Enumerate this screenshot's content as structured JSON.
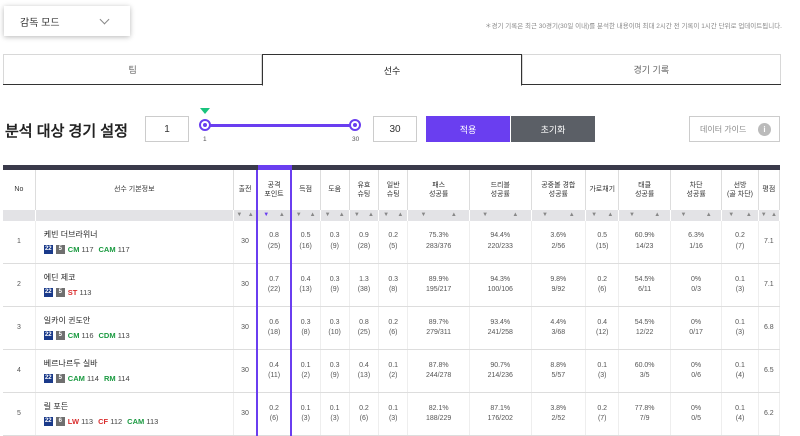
{
  "mode": {
    "label": "감독 모드"
  },
  "notice": "＊경기 기록은 최근 30경기(30일 이내)를 분석한 내용이며 최대 2시간 전 기록이 1시간 단위로 업데이트됩니다.",
  "tabs": [
    "팀",
    "선수",
    "경기 기록"
  ],
  "active_tab": "선수",
  "settings": {
    "title": "분석 대상 경기 설정",
    "min_value": "1",
    "max_value": "30",
    "slider_min_label": "1",
    "slider_max_label": "30",
    "apply_label": "적용",
    "reset_label": "초기화",
    "guide_label": "데이터 가이드",
    "guide_icon": "i"
  },
  "colors": {
    "accent": "#6a3ef0",
    "reset_bg": "#5b5f66"
  },
  "table": {
    "headers": [
      "No",
      "선수 기본정보",
      "출전",
      "공격\n포인트",
      "득점",
      "도움",
      "유효\n슈팅",
      "일반\n슈팅",
      "패스\n성공률",
      "드리블\n성공률",
      "공중볼 경합\n성공률",
      "가로채기",
      "태클\n성공률",
      "차단\n성공률",
      "선방\n(골 차단)",
      "평점"
    ],
    "rows": [
      {
        "no": "1",
        "name": "케빈 더브라위너",
        "badge1": "22",
        "badge2": "5",
        "positions": [
          {
            "pos": "CM",
            "val": "117",
            "cls": "cm"
          },
          {
            "pos": "CAM",
            "val": "117",
            "cls": "cam"
          }
        ],
        "apps": "30",
        "ap": [
          "0.8",
          "(25)"
        ],
        "goal": [
          "0.5",
          "(16)"
        ],
        "assist": [
          "0.3",
          "(9)"
        ],
        "eff": [
          "0.9",
          "(28)"
        ],
        "shot": [
          "0.2",
          "(5)"
        ],
        "pass": [
          "75.3%",
          "283/376"
        ],
        "drib": [
          "94.4%",
          "220/233"
        ],
        "aerial": [
          "3.6%",
          "2/56"
        ],
        "int": [
          "0.5",
          "(15)"
        ],
        "tackle": [
          "60.9%",
          "14/23"
        ],
        "block": [
          "6.3%",
          "1/16"
        ],
        "save": [
          "0.2",
          "(7)"
        ],
        "rating": "7.1"
      },
      {
        "no": "2",
        "name": "에딘 제코",
        "badge1": "22",
        "badge2": "5",
        "positions": [
          {
            "pos": "ST",
            "val": "113",
            "cls": "st"
          }
        ],
        "apps": "30",
        "ap": [
          "0.7",
          "(22)"
        ],
        "goal": [
          "0.4",
          "(13)"
        ],
        "assist": [
          "0.3",
          "(9)"
        ],
        "eff": [
          "1.3",
          "(38)"
        ],
        "shot": [
          "0.3",
          "(8)"
        ],
        "pass": [
          "89.9%",
          "195/217"
        ],
        "drib": [
          "94.3%",
          "100/106"
        ],
        "aerial": [
          "9.8%",
          "9/92"
        ],
        "int": [
          "0.2",
          "(6)"
        ],
        "tackle": [
          "54.5%",
          "6/11"
        ],
        "block": [
          "0%",
          "0/3"
        ],
        "save": [
          "0.1",
          "(3)"
        ],
        "rating": "7.1"
      },
      {
        "no": "3",
        "name": "일카이 귄도안",
        "badge1": "22",
        "badge2": "5",
        "positions": [
          {
            "pos": "CM",
            "val": "116",
            "cls": "cm"
          },
          {
            "pos": "CDM",
            "val": "113",
            "cls": "cdm"
          }
        ],
        "apps": "30",
        "ap": [
          "0.6",
          "(18)"
        ],
        "goal": [
          "0.3",
          "(8)"
        ],
        "assist": [
          "0.3",
          "(10)"
        ],
        "eff": [
          "0.8",
          "(25)"
        ],
        "shot": [
          "0.2",
          "(6)"
        ],
        "pass": [
          "89.7%",
          "279/311"
        ],
        "drib": [
          "93.4%",
          "241/258"
        ],
        "aerial": [
          "4.4%",
          "3/68"
        ],
        "int": [
          "0.4",
          "(12)"
        ],
        "tackle": [
          "54.5%",
          "12/22"
        ],
        "block": [
          "0%",
          "0/17"
        ],
        "save": [
          "0.1",
          "(3)"
        ],
        "rating": "6.8"
      },
      {
        "no": "4",
        "name": "베르나르두 실바",
        "badge1": "22",
        "badge2": "5",
        "positions": [
          {
            "pos": "CAM",
            "val": "114",
            "cls": "cam"
          },
          {
            "pos": "RM",
            "val": "114",
            "cls": "rm"
          }
        ],
        "apps": "30",
        "ap": [
          "0.4",
          "(11)"
        ],
        "goal": [
          "0.1",
          "(2)"
        ],
        "assist": [
          "0.3",
          "(9)"
        ],
        "eff": [
          "0.4",
          "(13)"
        ],
        "shot": [
          "0.1",
          "(2)"
        ],
        "pass": [
          "87.8%",
          "244/278"
        ],
        "drib": [
          "90.7%",
          "214/236"
        ],
        "aerial": [
          "8.8%",
          "5/57"
        ],
        "int": [
          "0.1",
          "(3)"
        ],
        "tackle": [
          "60.0%",
          "3/5"
        ],
        "block": [
          "0%",
          "0/6"
        ],
        "save": [
          "0.1",
          "(4)"
        ],
        "rating": "6.5"
      },
      {
        "no": "5",
        "name": "릴 포든",
        "badge1": "22",
        "badge2": "6",
        "positions": [
          {
            "pos": "LW",
            "val": "113",
            "cls": "lw"
          },
          {
            "pos": "CF",
            "val": "112",
            "cls": "cf"
          },
          {
            "pos": "CAM",
            "val": "113",
            "cls": "cam"
          }
        ],
        "apps": "30",
        "ap": [
          "0.2",
          "(6)"
        ],
        "goal": [
          "0.1",
          "(3)"
        ],
        "assist": [
          "0.1",
          "(3)"
        ],
        "eff": [
          "0.2",
          "(6)"
        ],
        "shot": [
          "0.1",
          "(3)"
        ],
        "pass": [
          "82.1%",
          "188/229"
        ],
        "drib": [
          "87.1%",
          "176/202"
        ],
        "aerial": [
          "3.8%",
          "2/52"
        ],
        "int": [
          "0.2",
          "(7)"
        ],
        "tackle": [
          "77.8%",
          "7/9"
        ],
        "block": [
          "0%",
          "0/5"
        ],
        "save": [
          "0.1",
          "(4)"
        ],
        "rating": "6.2"
      }
    ]
  }
}
